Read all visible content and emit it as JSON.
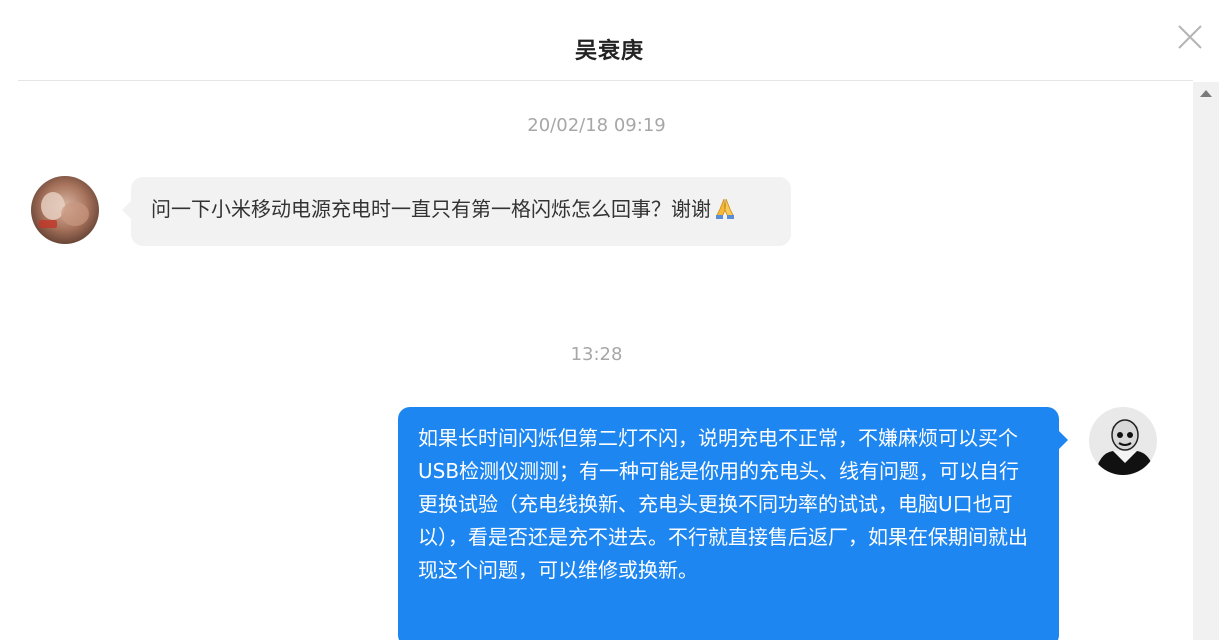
{
  "header": {
    "title": "吴衰庚",
    "close_icon": "close-icon"
  },
  "conversation": {
    "messages": [
      {
        "timestamp": "20/02/18 09:19",
        "sender": "incoming",
        "text": "问一下小米移动电源充电时一直只有第一格闪烁怎么回事？谢谢",
        "emoji_icon": "folded-hands-icon"
      },
      {
        "timestamp": "13:28",
        "sender": "outgoing",
        "text": "如果长时间闪烁但第二灯不闪，说明充电不正常，不嫌麻烦可以买个USB检测仪测测；有一种可能是你用的充电头、线有问题，可以自行更换试验（充电线换新、充电头更换不同功率的试试，电脑U口也可以），看是否还是充不进去。不行就直接售后返厂，如果在保期间就出现这个问题，可以维修或换新。"
      }
    ]
  },
  "colors": {
    "outgoing_bubble": "#1d86f0",
    "incoming_bubble": "#f2f2f2",
    "timestamp_text": "#a7a7a7"
  }
}
